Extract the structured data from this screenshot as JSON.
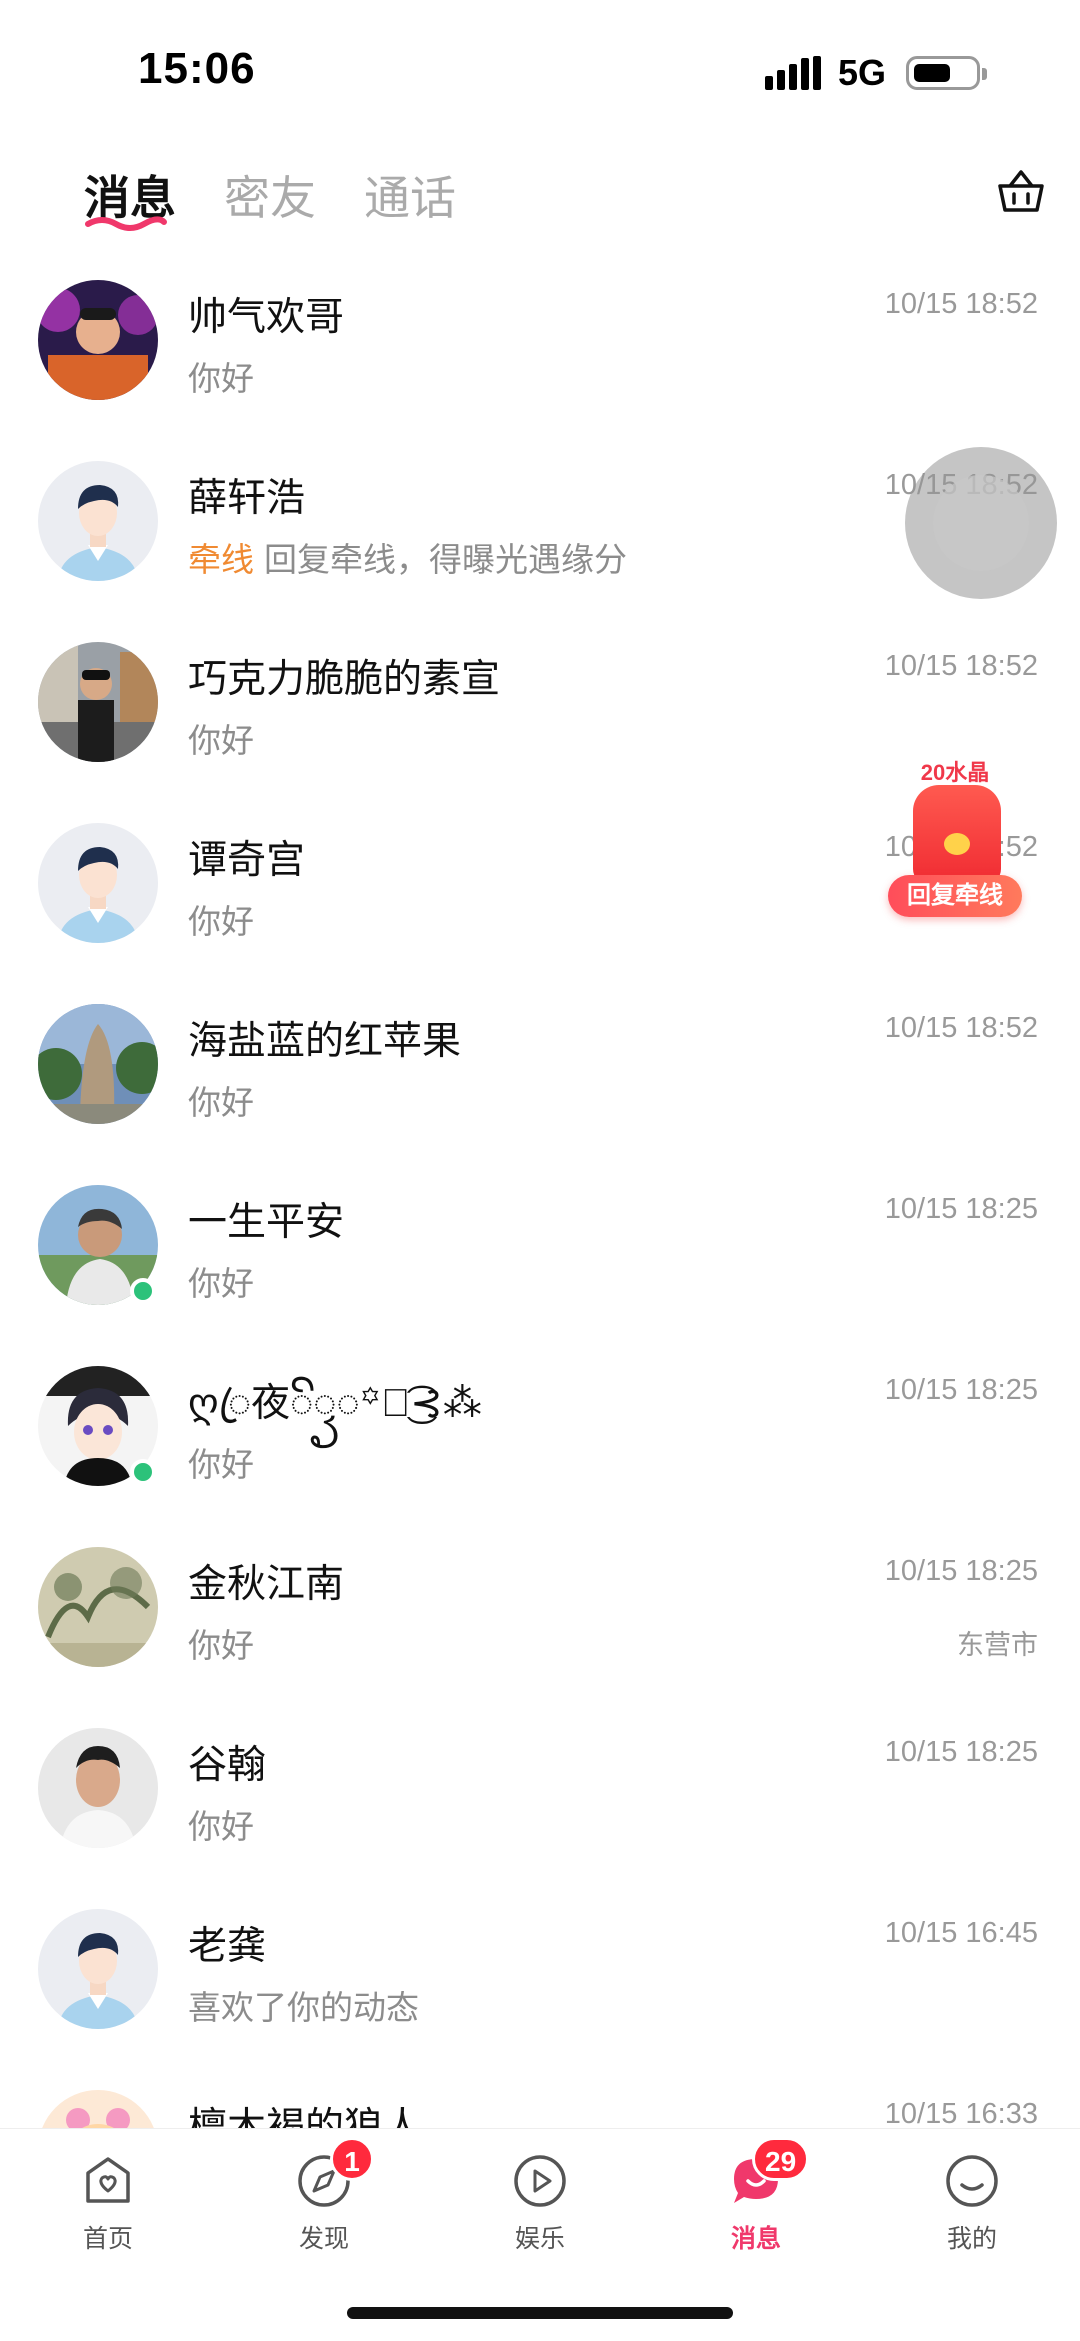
{
  "status_bar": {
    "time": "15:06",
    "network": "5G"
  },
  "top_tabs": [
    {
      "label": "消息",
      "active": true
    },
    {
      "label": "密友",
      "active": false
    },
    {
      "label": "通话",
      "active": false
    }
  ],
  "conversations": [
    {
      "name": "帅气欢哥",
      "preview": "你好",
      "time": "10/15 18:52",
      "avatar": "photo-man-neon"
    },
    {
      "name": "薛轩浩",
      "tag": "牵线",
      "preview": "回复牵线，得曝光遇缘分",
      "time": "10/15 18:52",
      "avatar": "default-male"
    },
    {
      "name": "巧克力脆脆的素宣",
      "preview": "你好",
      "time": "10/15 18:52",
      "avatar": "photo-man-street"
    },
    {
      "name": "谭奇宫",
      "preview": "你好",
      "time": "10/15 18:52",
      "avatar": "default-male"
    },
    {
      "name": "海盐蓝的红苹果",
      "preview": "你好",
      "time": "10/15 18:52",
      "avatar": "photo-rock-garden"
    },
    {
      "name": "一生平安",
      "preview": "你好",
      "time": "10/15 18:25",
      "avatar": "photo-man-outdoor",
      "online": true
    },
    {
      "name": "ღꦿ夜ꦼꦽ◌꙳ᰔ͜͡⊰⁂",
      "preview": "你好",
      "time": "10/15 18:25",
      "avatar": "anime-boy",
      "online": true
    },
    {
      "name": "金秋江南",
      "preview": "你好",
      "time": "10/15 18:25",
      "location": "东营市",
      "avatar": "ink-painting"
    },
    {
      "name": "谷翰",
      "preview": "你好",
      "time": "10/15 18:25",
      "avatar": "photo-man-selfie"
    },
    {
      "name": "老龚",
      "preview": "喜欢了你的动态",
      "time": "10/15 16:45",
      "avatar": "default-male"
    },
    {
      "name": "檀木褐的狼人",
      "preview": "",
      "time": "10/15 16:33",
      "avatar": "cartoon-pink"
    }
  ],
  "promo": {
    "label": "20水晶",
    "button": "回复牵线"
  },
  "bottom_nav": [
    {
      "label": "首页",
      "icon": "home-heart-icon"
    },
    {
      "label": "发现",
      "icon": "compass-icon",
      "badge": "1"
    },
    {
      "label": "娱乐",
      "icon": "play-icon"
    },
    {
      "label": "消息",
      "icon": "chat-bubble-icon",
      "badge": "29",
      "active": true
    },
    {
      "label": "我的",
      "icon": "smile-face-icon"
    }
  ],
  "colors": {
    "accent": "#f0386b",
    "tag_orange": "#f08a32",
    "badge_red": "#ff2a3d",
    "online_green": "#2cc27a"
  }
}
